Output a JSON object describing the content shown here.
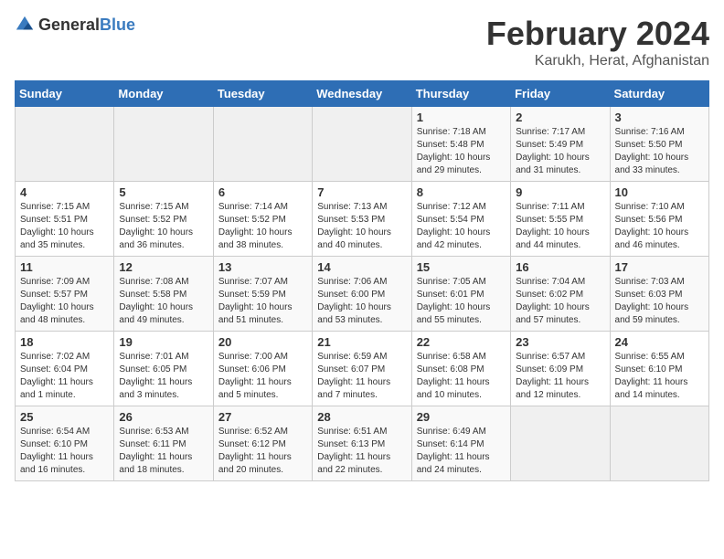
{
  "header": {
    "logo_general": "General",
    "logo_blue": "Blue",
    "title": "February 2024",
    "subtitle": "Karukh, Herat, Afghanistan"
  },
  "weekdays": [
    "Sunday",
    "Monday",
    "Tuesday",
    "Wednesday",
    "Thursday",
    "Friday",
    "Saturday"
  ],
  "weeks": [
    [
      {
        "day": "",
        "info": ""
      },
      {
        "day": "",
        "info": ""
      },
      {
        "day": "",
        "info": ""
      },
      {
        "day": "",
        "info": ""
      },
      {
        "day": "1",
        "info": "Sunrise: 7:18 AM\nSunset: 5:48 PM\nDaylight: 10 hours\nand 29 minutes."
      },
      {
        "day": "2",
        "info": "Sunrise: 7:17 AM\nSunset: 5:49 PM\nDaylight: 10 hours\nand 31 minutes."
      },
      {
        "day": "3",
        "info": "Sunrise: 7:16 AM\nSunset: 5:50 PM\nDaylight: 10 hours\nand 33 minutes."
      }
    ],
    [
      {
        "day": "4",
        "info": "Sunrise: 7:15 AM\nSunset: 5:51 PM\nDaylight: 10 hours\nand 35 minutes."
      },
      {
        "day": "5",
        "info": "Sunrise: 7:15 AM\nSunset: 5:52 PM\nDaylight: 10 hours\nand 36 minutes."
      },
      {
        "day": "6",
        "info": "Sunrise: 7:14 AM\nSunset: 5:52 PM\nDaylight: 10 hours\nand 38 minutes."
      },
      {
        "day": "7",
        "info": "Sunrise: 7:13 AM\nSunset: 5:53 PM\nDaylight: 10 hours\nand 40 minutes."
      },
      {
        "day": "8",
        "info": "Sunrise: 7:12 AM\nSunset: 5:54 PM\nDaylight: 10 hours\nand 42 minutes."
      },
      {
        "day": "9",
        "info": "Sunrise: 7:11 AM\nSunset: 5:55 PM\nDaylight: 10 hours\nand 44 minutes."
      },
      {
        "day": "10",
        "info": "Sunrise: 7:10 AM\nSunset: 5:56 PM\nDaylight: 10 hours\nand 46 minutes."
      }
    ],
    [
      {
        "day": "11",
        "info": "Sunrise: 7:09 AM\nSunset: 5:57 PM\nDaylight: 10 hours\nand 48 minutes."
      },
      {
        "day": "12",
        "info": "Sunrise: 7:08 AM\nSunset: 5:58 PM\nDaylight: 10 hours\nand 49 minutes."
      },
      {
        "day": "13",
        "info": "Sunrise: 7:07 AM\nSunset: 5:59 PM\nDaylight: 10 hours\nand 51 minutes."
      },
      {
        "day": "14",
        "info": "Sunrise: 7:06 AM\nSunset: 6:00 PM\nDaylight: 10 hours\nand 53 minutes."
      },
      {
        "day": "15",
        "info": "Sunrise: 7:05 AM\nSunset: 6:01 PM\nDaylight: 10 hours\nand 55 minutes."
      },
      {
        "day": "16",
        "info": "Sunrise: 7:04 AM\nSunset: 6:02 PM\nDaylight: 10 hours\nand 57 minutes."
      },
      {
        "day": "17",
        "info": "Sunrise: 7:03 AM\nSunset: 6:03 PM\nDaylight: 10 hours\nand 59 minutes."
      }
    ],
    [
      {
        "day": "18",
        "info": "Sunrise: 7:02 AM\nSunset: 6:04 PM\nDaylight: 11 hours\nand 1 minute."
      },
      {
        "day": "19",
        "info": "Sunrise: 7:01 AM\nSunset: 6:05 PM\nDaylight: 11 hours\nand 3 minutes."
      },
      {
        "day": "20",
        "info": "Sunrise: 7:00 AM\nSunset: 6:06 PM\nDaylight: 11 hours\nand 5 minutes."
      },
      {
        "day": "21",
        "info": "Sunrise: 6:59 AM\nSunset: 6:07 PM\nDaylight: 11 hours\nand 7 minutes."
      },
      {
        "day": "22",
        "info": "Sunrise: 6:58 AM\nSunset: 6:08 PM\nDaylight: 11 hours\nand 10 minutes."
      },
      {
        "day": "23",
        "info": "Sunrise: 6:57 AM\nSunset: 6:09 PM\nDaylight: 11 hours\nand 12 minutes."
      },
      {
        "day": "24",
        "info": "Sunrise: 6:55 AM\nSunset: 6:10 PM\nDaylight: 11 hours\nand 14 minutes."
      }
    ],
    [
      {
        "day": "25",
        "info": "Sunrise: 6:54 AM\nSunset: 6:10 PM\nDaylight: 11 hours\nand 16 minutes."
      },
      {
        "day": "26",
        "info": "Sunrise: 6:53 AM\nSunset: 6:11 PM\nDaylight: 11 hours\nand 18 minutes."
      },
      {
        "day": "27",
        "info": "Sunrise: 6:52 AM\nSunset: 6:12 PM\nDaylight: 11 hours\nand 20 minutes."
      },
      {
        "day": "28",
        "info": "Sunrise: 6:51 AM\nSunset: 6:13 PM\nDaylight: 11 hours\nand 22 minutes."
      },
      {
        "day": "29",
        "info": "Sunrise: 6:49 AM\nSunset: 6:14 PM\nDaylight: 11 hours\nand 24 minutes."
      },
      {
        "day": "",
        "info": ""
      },
      {
        "day": "",
        "info": ""
      }
    ]
  ]
}
